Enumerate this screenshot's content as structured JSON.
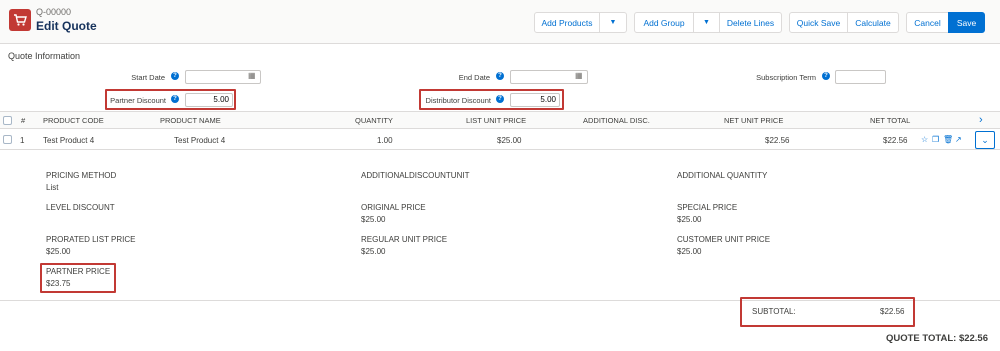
{
  "header": {
    "quote_number": "Q-00000",
    "title": "Edit Quote",
    "buttons": {
      "add_products": "Add Products",
      "add_group": "Add Group",
      "delete_lines": "Delete Lines",
      "quick_save": "Quick Save",
      "calculate": "Calculate",
      "cancel": "Cancel",
      "save": "Save"
    }
  },
  "quote_info": {
    "section_title": "Quote Information",
    "start_date_label": "Start Date",
    "end_date_label": "End Date",
    "subscription_term_label": "Subscription Term",
    "partner_discount_label": "Partner Discount",
    "partner_discount_value": "5.00",
    "distributor_discount_label": "Distributor Discount",
    "distributor_discount_value": "5.00"
  },
  "table": {
    "row_number_header": "#",
    "columns": [
      "PRODUCT CODE",
      "PRODUCT NAME",
      "QUANTITY",
      "LIST UNIT PRICE",
      "ADDITIONAL DISC.",
      "NET UNIT PRICE",
      "NET TOTAL"
    ],
    "rows": [
      {
        "number": "1",
        "product_code": "Test Product 4",
        "product_name": "Test Product 4",
        "quantity": "1.00",
        "list_unit_price": "$25.00",
        "additional_disc": "",
        "net_unit_price": "$22.56",
        "net_total": "$22.56"
      }
    ]
  },
  "details": {
    "pricing_method_label": "PRICING METHOD",
    "pricing_method_value": "List",
    "additional_discount_unit_label": "ADDITIONALDISCOUNTUNIT",
    "additional_quantity_label": "ADDITIONAL QUANTITY",
    "level_discount_label": "LEVEL DISCOUNT",
    "original_price_label": "ORIGINAL PRICE",
    "original_price_value": "$25.00",
    "special_price_label": "SPECIAL PRICE",
    "special_price_value": "$25.00",
    "prorated_list_price_label": "PRORATED LIST PRICE",
    "prorated_list_price_value": "$25.00",
    "regular_unit_price_label": "REGULAR UNIT PRICE",
    "regular_unit_price_value": "$25.00",
    "customer_unit_price_label": "CUSTOMER UNIT PRICE",
    "customer_unit_price_value": "$25.00",
    "partner_price_label": "PARTNER PRICE",
    "partner_price_value": "$23.75"
  },
  "subtotal": {
    "label": "SUBTOTAL:",
    "value": "$22.56"
  },
  "quote_total": "QUOTE TOTAL: $22.56",
  "colors": {
    "brand_blue": "#0070d2",
    "highlight_red": "#c23934"
  }
}
